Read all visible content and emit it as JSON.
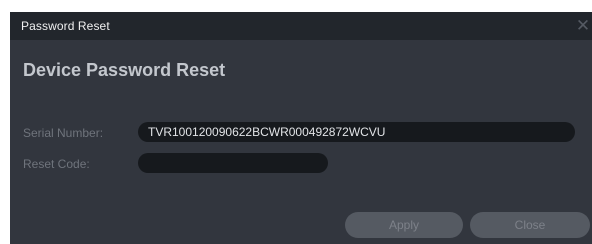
{
  "window": {
    "title": "Password Reset",
    "close_glyph": "✕"
  },
  "heading": "Device Password Reset",
  "form": {
    "serial_label": "Serial Number:",
    "serial_value": "TVR100120090622BCWR000492872WCVU",
    "reset_label": "Reset Code:",
    "reset_value": ""
  },
  "buttons": {
    "apply": "Apply",
    "close": "Close"
  },
  "colors": {
    "dialog_bg": "#32363e",
    "titlebar_bg": "#22262c",
    "field_bg": "#16191d",
    "button_bg": "#555a62"
  }
}
